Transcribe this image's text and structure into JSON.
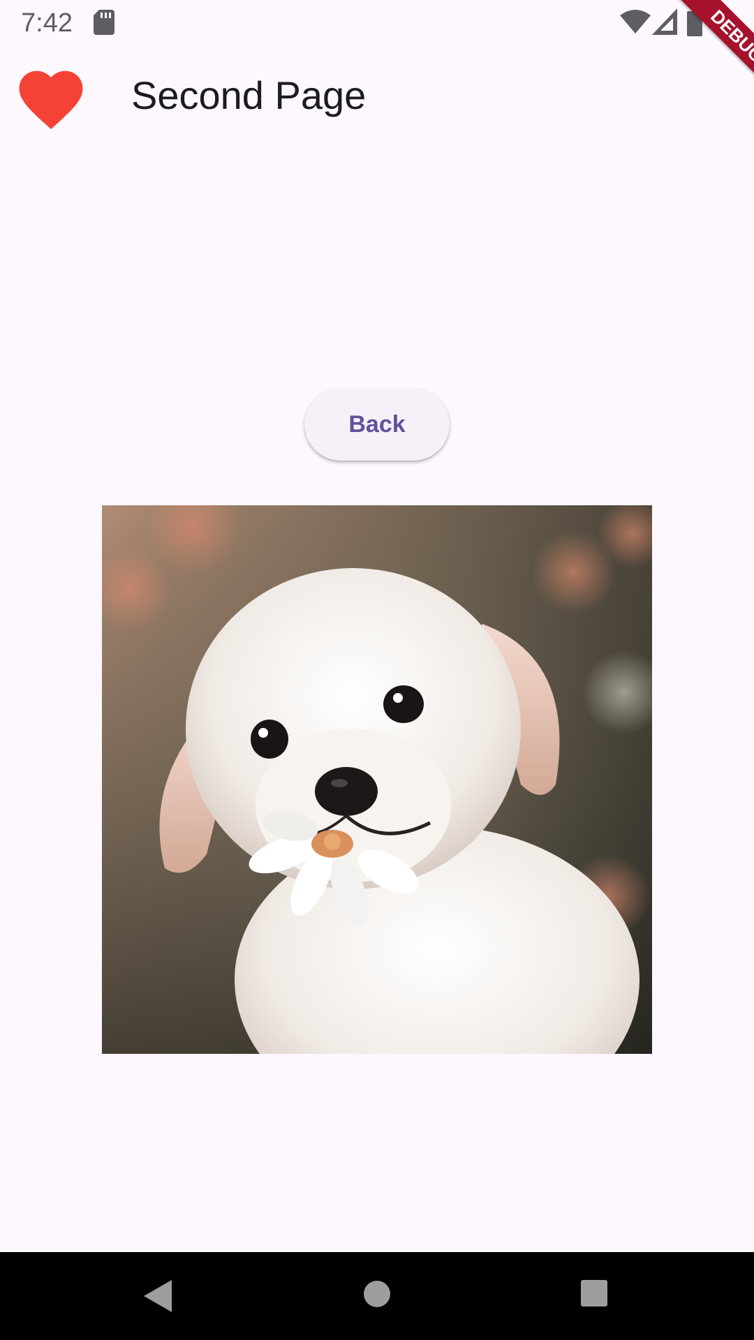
{
  "status_bar": {
    "time": "7:42",
    "icons": [
      "sd-card-icon",
      "wifi-icon",
      "cell-signal-icon",
      "battery-icon"
    ]
  },
  "debug_banner": {
    "label": "DEBUG",
    "color": "#a6122b"
  },
  "app_bar": {
    "leading_icon": "heart-icon",
    "leading_icon_color": "#f44336",
    "title": "Second Page"
  },
  "main": {
    "back_button_label": "Back",
    "image": "puppy-with-daisy-photo"
  },
  "nav_bar": {
    "icons": [
      "nav-back-icon",
      "nav-home-icon",
      "nav-recents-icon"
    ]
  },
  "colors": {
    "background": "#fdf7fe",
    "button_text": "#63509d",
    "button_bg": "#f6f1f8"
  }
}
